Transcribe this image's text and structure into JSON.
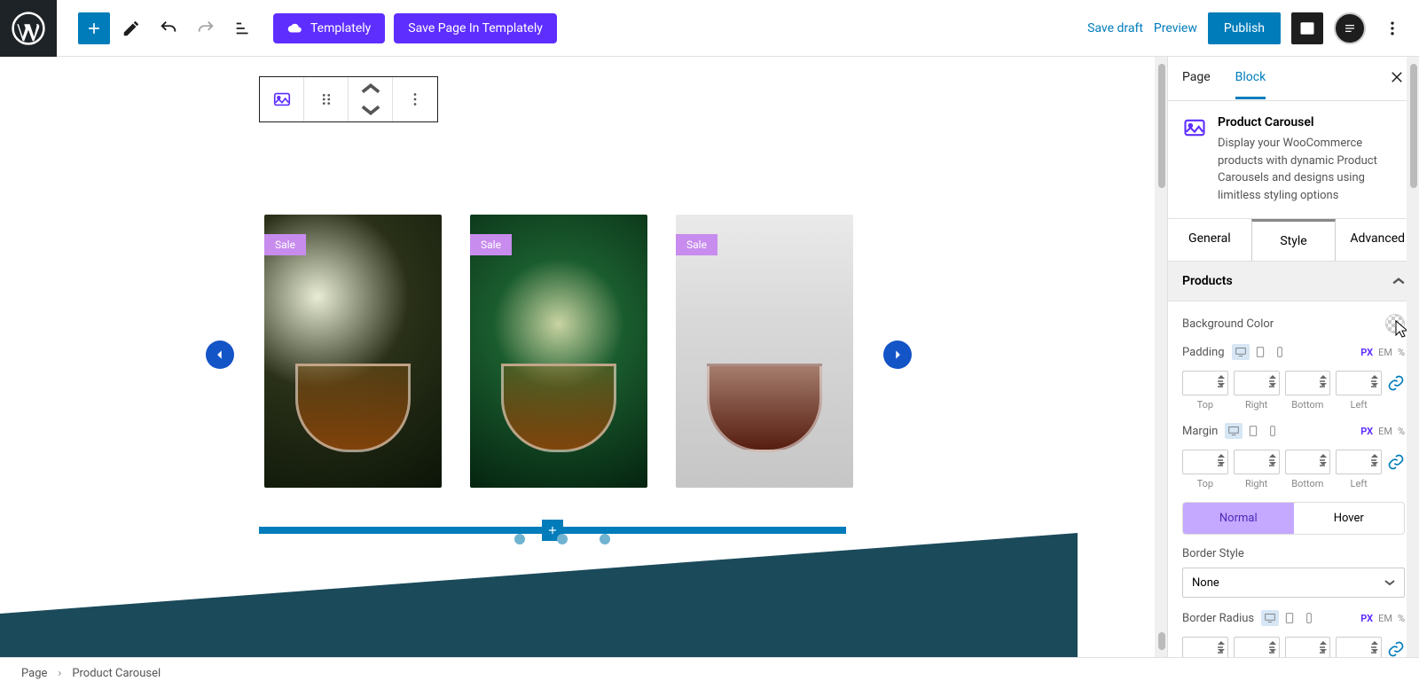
{
  "topbar": {
    "templately_label": "Templately",
    "save_templately_label": "Save Page In Templately",
    "save_draft": "Save draft",
    "preview": "Preview",
    "publish": "Publish"
  },
  "carousel": {
    "sale_label": "Sale"
  },
  "sidebar": {
    "tabs": {
      "page": "Page",
      "block": "Block"
    },
    "block_title": "Product Carousel",
    "block_desc": "Display your WooCommerce products with dynamic Product Carousels and designs using limitless styling options",
    "style_tabs": {
      "general": "General",
      "style": "Style",
      "advanced": "Advanced"
    },
    "panel_products": "Products",
    "bg_color_label": "Background Color",
    "padding_label": "Padding",
    "margin_label": "Margin",
    "border_radius_label": "Border Radius",
    "units": {
      "px": "PX",
      "em": "EM",
      "pct": "%"
    },
    "sides": {
      "top": "Top",
      "right": "Right",
      "bottom": "Bottom",
      "left": "Left"
    },
    "state_tabs": {
      "normal": "Normal",
      "hover": "Hover"
    },
    "border_style_label": "Border Style",
    "border_style_value": "None"
  },
  "breadcrumb": {
    "page": "Page",
    "block": "Product Carousel"
  }
}
